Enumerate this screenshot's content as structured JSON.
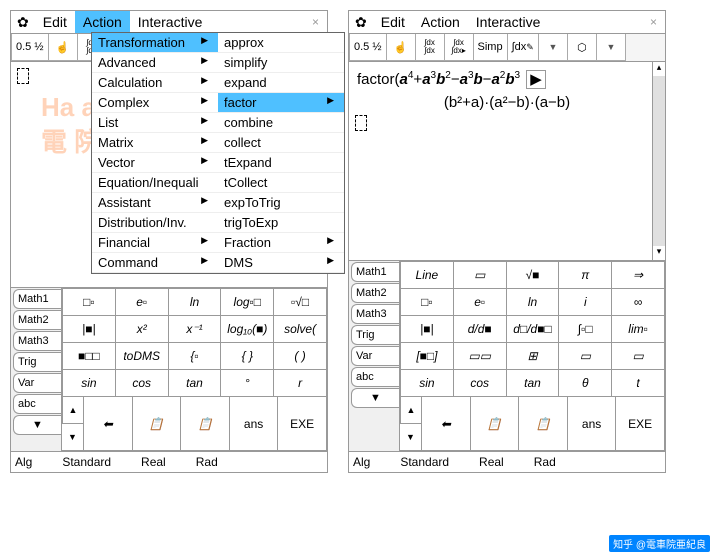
{
  "menubar": {
    "edit": "Edit",
    "action": "Action",
    "interactive": "Interactive"
  },
  "toolbar": {
    "frac": "0.5 ½",
    "hand": "☝",
    "int1": "∫dx\n∫dx",
    "int2": "∫dx\n∫dx▸",
    "simp": "Simp",
    "intpen": "∫dx✎",
    "graph": "⬡"
  },
  "dropdown": {
    "col1": [
      "Transformation",
      "Advanced",
      "Calculation",
      "Complex",
      "List",
      "Matrix",
      "Vector",
      "Equation/Inequali",
      "Assistant",
      "Distribution/Inv.",
      "Financial",
      "Command"
    ],
    "col2": [
      "approx",
      "simplify",
      "expand",
      "factor",
      "combine",
      "collect",
      "tExpand",
      "tCollect",
      "expToTrig",
      "trigToExp",
      "Fraction",
      "DMS"
    ]
  },
  "tabs": [
    "Math1",
    "Math2",
    "Math3",
    "Trig",
    "Var",
    "abc"
  ],
  "keys_left": [
    [
      "□▫",
      "e▫",
      "ln",
      "log▫□",
      "▫√□"
    ],
    [
      "|■|",
      "x²",
      "x⁻¹",
      "log₁₀(■)",
      "solve("
    ],
    [
      "■□□",
      "toDMS",
      "{▫",
      "{ }",
      "( )"
    ],
    [
      "sin",
      "cos",
      "tan",
      "°",
      "r"
    ]
  ],
  "keys_right": [
    [
      "Line",
      "▭",
      "√■",
      "π",
      "⇒"
    ],
    [
      "□▫",
      "e▫",
      "ln",
      "i",
      "∞"
    ],
    [
      "|■|",
      "d/d■",
      "d□/d■□",
      "∫▫□",
      "lim▫"
    ],
    [
      "[■□]",
      "▭▭",
      "⊞",
      "▭",
      "▭"
    ],
    [
      "sin",
      "cos",
      "tan",
      "θ",
      "t"
    ]
  ],
  "nav": {
    "back": "⬅",
    "copy1": "📋",
    "copy2": "📋",
    "ans": "ans",
    "exe": "EXE",
    "up": "▲",
    "down": "▼"
  },
  "status": {
    "alg": "Alg",
    "std": "Standard",
    "real": "Real",
    "rad": "Rad"
  },
  "right_panel": {
    "expr": "factor(𝒂⁴+𝒂³𝒃²−𝒂³𝒃−𝒂²𝒃³",
    "play": "▶",
    "result": "(b²+a)·(a²−b)·(a−b)"
  },
  "watermark": {
    "l1": "Ha          a G     p",
    "l2": "電   院亜   "
  },
  "attribution": "知乎 @電車院亜紀良"
}
